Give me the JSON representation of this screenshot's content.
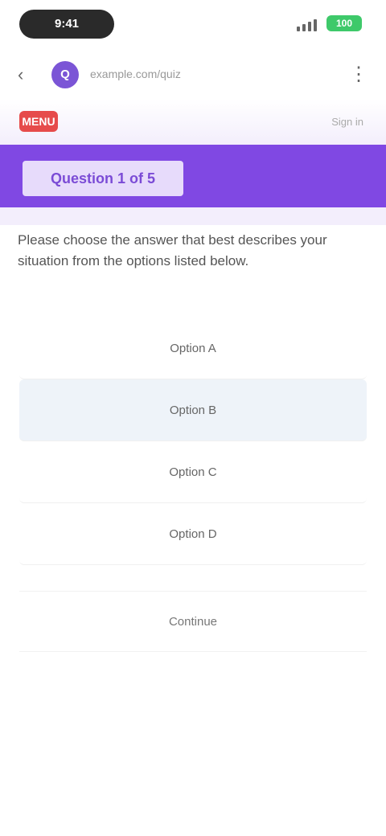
{
  "status_bar": {
    "time": "9:41",
    "battery": "100"
  },
  "browser": {
    "back_glyph": "‹",
    "site_initial": "Q",
    "url": "example.com/quiz",
    "menu_glyph": "⋮"
  },
  "site_header": {
    "logo_text": "MENU",
    "right_text": "Sign in"
  },
  "banner": {
    "label": "Question 1 of 5"
  },
  "intro": {
    "text": "Please choose the answer that best describes your situation from the options listed below."
  },
  "options": [
    {
      "label": "Option A"
    },
    {
      "label": "Option B"
    },
    {
      "label": "Option C"
    },
    {
      "label": "Option D"
    }
  ],
  "footer": {
    "label": "Continue"
  },
  "colors": {
    "accent": "#8048e3",
    "selected_bg": "#eef3f9",
    "logo": "#e64b4b"
  }
}
